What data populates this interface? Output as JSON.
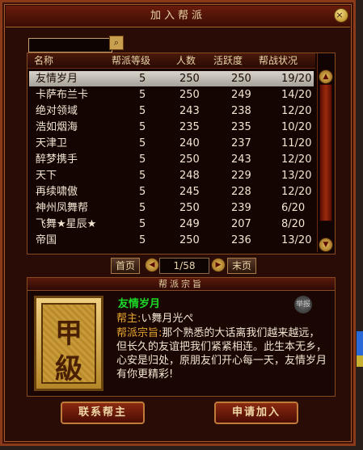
{
  "title": "加入帮派",
  "close_label": "×",
  "search": {
    "value": "",
    "icon": "search-icon",
    "icon_glyph": "⌕"
  },
  "columns": [
    "名称",
    "帮派等级",
    "人数",
    "活跃度",
    "帮战状况"
  ],
  "rows": [
    {
      "name": "友情岁月",
      "level": "5",
      "members": "250",
      "activity": "250",
      "war": "19/20"
    },
    {
      "name": "卡萨布兰卡",
      "level": "5",
      "members": "250",
      "activity": "249",
      "war": "14/20"
    },
    {
      "name": "绝对领域",
      "level": "5",
      "members": "243",
      "activity": "238",
      "war": "12/20"
    },
    {
      "name": "浩如烟海",
      "level": "5",
      "members": "235",
      "activity": "235",
      "war": "10/20"
    },
    {
      "name": "天津卫",
      "level": "5",
      "members": "240",
      "activity": "237",
      "war": "11/20"
    },
    {
      "name": "醉梦携手",
      "level": "5",
      "members": "250",
      "activity": "243",
      "war": "12/20"
    },
    {
      "name": "天下",
      "level": "5",
      "members": "248",
      "activity": "229",
      "war": "13/20"
    },
    {
      "name": "再续啸傲",
      "level": "5",
      "members": "245",
      "activity": "228",
      "war": "12/20"
    },
    {
      "name": "神州凤舞帮",
      "level": "5",
      "members": "250",
      "activity": "239",
      "war": "6/20"
    },
    {
      "name": "飞舞★星辰★",
      "level": "5",
      "members": "249",
      "activity": "207",
      "war": "8/20"
    },
    {
      "name": "帝国",
      "level": "5",
      "members": "250",
      "activity": "236",
      "war": "13/20"
    }
  ],
  "selected_row": 0,
  "pager": {
    "first": "首页",
    "page": "1/58",
    "last": "末页",
    "prev_glyph": "◀",
    "next_glyph": "▶"
  },
  "scroll": {
    "up_glyph": "▲",
    "down_glyph": "▼"
  },
  "guild_info": {
    "section_title": "帮派宗旨",
    "badge_chars": [
      "甲",
      "級"
    ],
    "name": "友情岁月",
    "report_label": "举报",
    "leader_label": "帮主:",
    "leader_value": "い舞月光ぺ",
    "tenet_label": "帮派宗旨:",
    "tenet_text": "那个熟悉的大话离我们越来越远，但长久的友谊把我们紧紧相连。此生本无乡，心安是归处，原朋友们开心每一天，友情岁月有你更精彩!"
  },
  "buttons": {
    "contact": "联系帮主",
    "apply": "申请加入"
  }
}
